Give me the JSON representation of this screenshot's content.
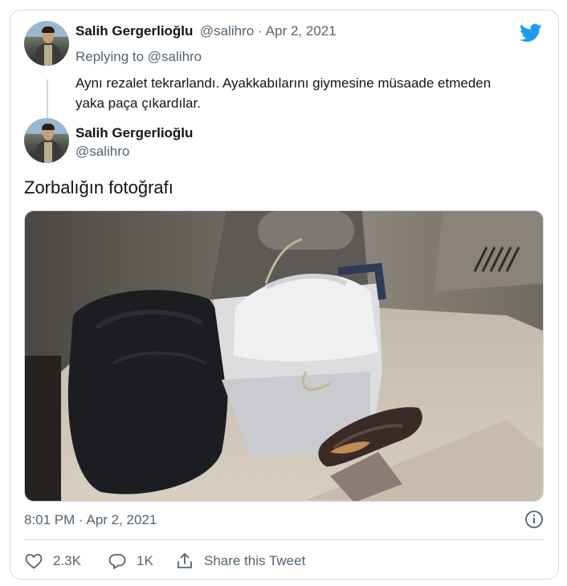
{
  "reply_tweet": {
    "author_name": "Salih Gergerlioğlu",
    "author_handle": "@salihro",
    "separator": "·",
    "date": "Apr 2, 2021",
    "replying_prefix": "Replying to",
    "replying_to": "@salihro",
    "text_line1": "Aynı rezalet tekrarlandı. Ayakkabılarını giymesine müsaade etmeden",
    "text_line2": "yaka paça çıkardılar."
  },
  "main_tweet": {
    "author_name": "Salih Gergerlioğlu",
    "author_handle": "@salihro",
    "text": "Zorbalığın fotoğrafı",
    "timestamp": "8:01 PM · Apr 2, 2021"
  },
  "actions": {
    "likes": "2.3K",
    "replies": "1K",
    "share_label": "Share this Tweet"
  },
  "icons": {
    "brand": "twitter-bird-icon",
    "info": "info-icon",
    "like": "heart-icon",
    "reply": "reply-bubble-icon",
    "share": "share-icon"
  },
  "colors": {
    "twitter_blue": "#1d9bf0",
    "text_primary": "#0f1419",
    "text_secondary": "#536471",
    "border": "#cfd9de"
  }
}
